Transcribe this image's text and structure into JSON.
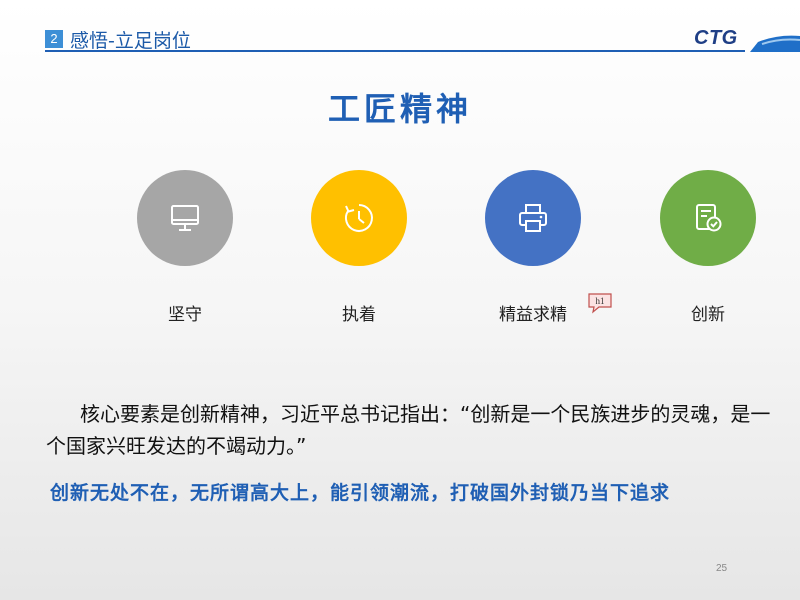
{
  "header": {
    "section_number": "2",
    "section_title": "感悟-立足岗位",
    "logo_text": "CTG"
  },
  "main_title": "工匠精神",
  "features": [
    {
      "label": "坚守",
      "icon": "monitor-icon",
      "color": "#a6a6a6"
    },
    {
      "label": "执着",
      "icon": "clock-icon",
      "color": "#ffc000"
    },
    {
      "label": "精益求精",
      "icon": "printer-icon",
      "color": "#4472c4"
    },
    {
      "label": "创新",
      "icon": "checklist-icon",
      "color": "#70ad47"
    }
  ],
  "comment_marker": "h1",
  "quote": "核心要素是创新精神，习近平总书记指出：“创新是一个民族进步的灵魂，是一个国家兴旺发达的不竭动力。”",
  "slogan": "创新无处不在，无所谓高大上，能引领潮流，打破国外封锁乃当下追求",
  "page_number": "25",
  "colors": {
    "brand_blue": "#1f5fb4",
    "badge_blue": "#3d8fd6"
  }
}
